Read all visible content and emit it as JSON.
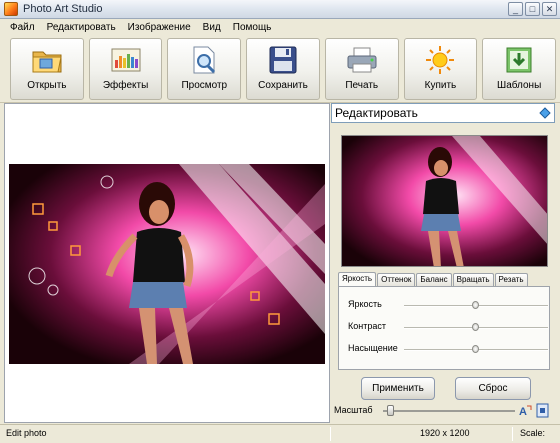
{
  "window": {
    "title": "Photo Art Studio"
  },
  "menu": [
    "Файл",
    "Редактировать",
    "Изображение",
    "Вид",
    "Помощь"
  ],
  "toolbar": [
    {
      "label": "Открыть",
      "icon": "folder-icon"
    },
    {
      "label": "Эффекты",
      "icon": "effects-icon"
    },
    {
      "label": "Просмотр",
      "icon": "preview-icon"
    },
    {
      "label": "Сохранить",
      "icon": "save-icon"
    },
    {
      "label": "Печать",
      "icon": "printer-icon"
    },
    {
      "label": "Купить",
      "icon": "sun-icon"
    },
    {
      "label": "Шаблоны",
      "icon": "templates-icon"
    }
  ],
  "panel": {
    "mode": "Редактировать",
    "tabs": [
      "Яркость",
      "Оттенок",
      "Баланс",
      "Вращать",
      "Резать"
    ],
    "active_tab": "Яркость",
    "sliders": [
      {
        "label": "Яркость",
        "value": 0.5
      },
      {
        "label": "Контраст",
        "value": 0.5
      },
      {
        "label": "Насыщение",
        "value": 0.5
      }
    ],
    "apply_label": "Применить",
    "reset_label": "Сброс",
    "zoom_label": "Масштаб",
    "zoom_value": 0.05
  },
  "status": {
    "text": "Edit photo",
    "resolution": "1920 x 1200",
    "scale": "Scale:"
  },
  "colors": {
    "accent": "#2f5ea8",
    "photo_pink": "#e9339a"
  }
}
